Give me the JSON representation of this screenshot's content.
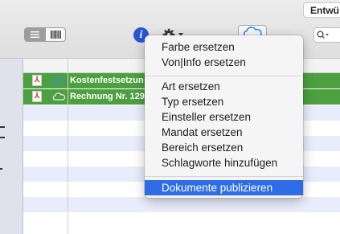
{
  "toolbar": {
    "tab_label": "Entwü",
    "view_toggle_icons": [
      "list-view-icon",
      "barcode-view-icon"
    ],
    "info_glyph": "i",
    "gear_icon": "gear-icon",
    "cloud_icon": "cloud-icon",
    "search_icon": "search-icon"
  },
  "documents": [
    {
      "title": "Kostenfestsetzun",
      "type_icon": "pdf-icon",
      "cloud_icon": "cloud-icon-blue"
    },
    {
      "title": "Rechnung Nr. 129",
      "type_icon": "pdf-icon",
      "cloud_icon": "cloud-icon-outline"
    }
  ],
  "context_menu": {
    "groups": [
      [
        "Farbe ersetzen",
        "Von|Info ersetzen"
      ],
      [
        "Art ersetzen",
        "Typ ersetzen",
        "Einsteller ersetzen",
        "Mandat ersetzen",
        "Bereich ersetzen",
        "Schlagworte hinzufügen"
      ],
      [
        "Dokumente publizieren"
      ]
    ],
    "highlighted": "Dokumente publizieren"
  },
  "colors": {
    "selection_green": "#4ca03f",
    "menu_highlight": "#2f6de6",
    "alt_row": "#e9ecfb",
    "info_blue": "#2a56d6"
  }
}
